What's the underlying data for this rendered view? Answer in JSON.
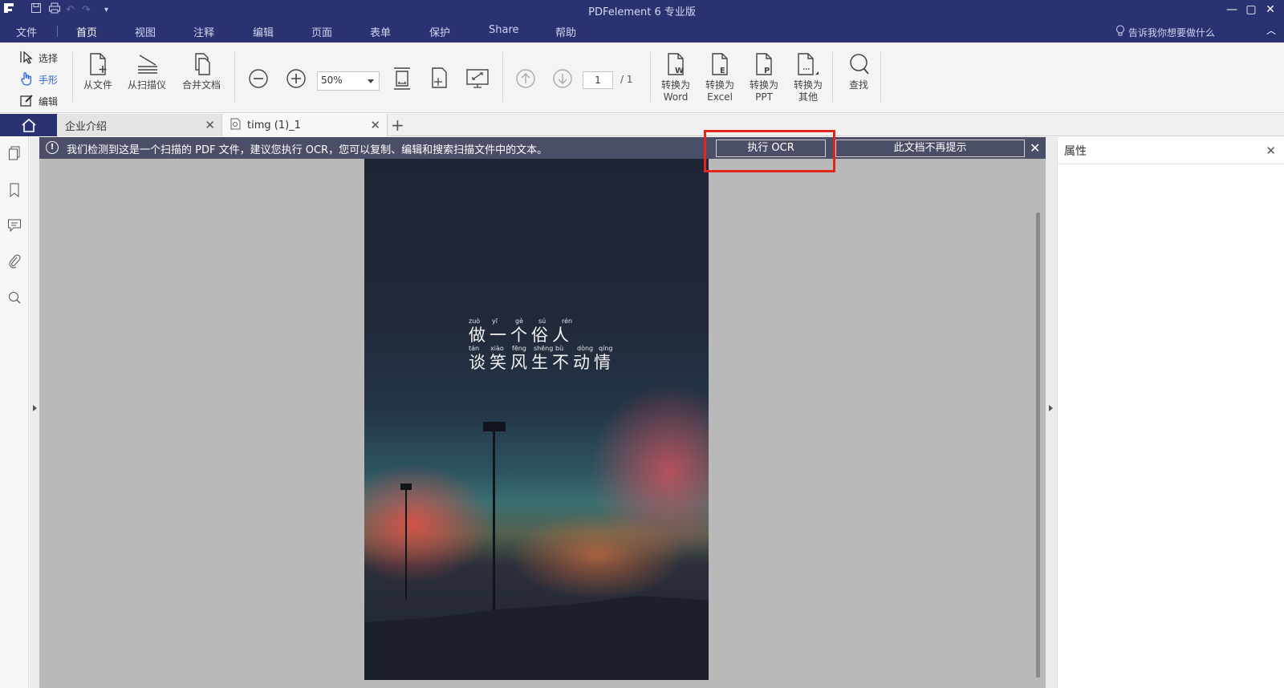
{
  "window": {
    "title": "PDFelement  6 专业版"
  },
  "menu": {
    "items": [
      {
        "label": "文件"
      },
      {
        "label": "首页"
      },
      {
        "label": "视图"
      },
      {
        "label": "注释"
      },
      {
        "label": "编辑"
      },
      {
        "label": "页面"
      },
      {
        "label": "表单"
      },
      {
        "label": "保护"
      },
      {
        "label": "Share"
      },
      {
        "label": "帮助"
      }
    ],
    "active": "首页",
    "tell_me": "告诉我你想要做什么"
  },
  "ribbon": {
    "modes": {
      "select": "选择",
      "hand": "手形",
      "edit": "编辑"
    },
    "create": {
      "from_file": "从文件",
      "from_scanner": "从扫描仪",
      "combine": "合并文档"
    },
    "zoom_value": "50%",
    "page_current": "1",
    "page_total": "/ 1",
    "convert": {
      "word": [
        "转换为",
        "Word"
      ],
      "excel": [
        "转换为",
        "Excel"
      ],
      "ppt": [
        "转换为",
        "PPT"
      ],
      "other": [
        "转换为",
        "其他"
      ]
    },
    "find": "查找"
  },
  "tabs": [
    {
      "label": "企业介绍"
    },
    {
      "label": "timg (1)_1"
    }
  ],
  "notice": {
    "message": "我们检测到这是一个扫描的 PDF 文件，建议您执行 OCR，您可以复制、编辑和搜索扫描文件中的文本。",
    "ocr_button": "执行 OCR",
    "dismiss_button": "此文档不再提示"
  },
  "poem": {
    "line1_pinyin": [
      "zuò",
      "yī",
      "gè",
      "sú",
      "rén"
    ],
    "line1": "做一个俗人",
    "line2_pinyin": [
      "tán",
      "xiào",
      "fēng",
      "shēng",
      "bù",
      "dòng",
      "qíng"
    ],
    "line2": "谈笑风生不动情"
  },
  "properties": {
    "title": "属性"
  },
  "colors": {
    "chrome": "#2b3272",
    "highlight": "#e0261d",
    "accent": "#2a66d9"
  }
}
